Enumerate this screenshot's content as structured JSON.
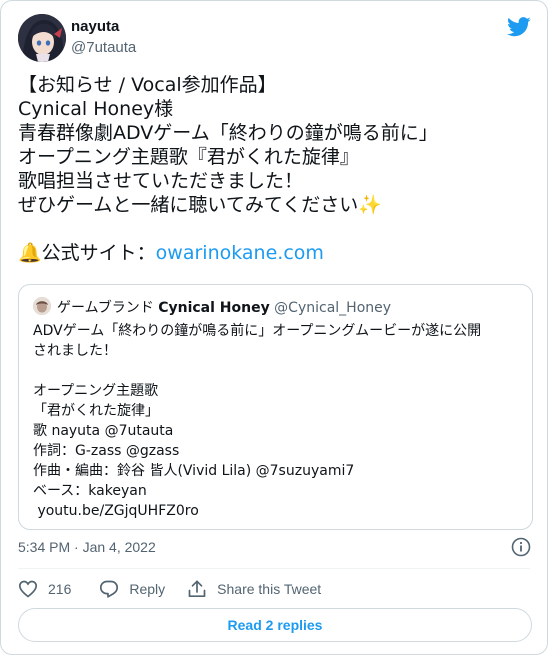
{
  "author": {
    "name": "nayuta",
    "handle": "@7utauta"
  },
  "tweet": {
    "lines": [
      "【お知らせ / Vocal参加作品】",
      "Cynical Honey様",
      "青春群像劇ADVゲーム「終わりの鐘が鳴る前に」",
      "オープニング主題歌『君がくれた旋律』",
      "歌唱担当させていただきました！",
      "ぜひゲームと一緒に聴いてみてください✨"
    ],
    "site_label": "🔔公式サイト：",
    "site_link": "owarinokane.com",
    "timestamp": "5:34 PM · Jan 4, 2022"
  },
  "quote": {
    "prefix": "ゲームブランド",
    "name": "Cynical Honey",
    "handle": "@Cynical_Honey",
    "lines": [
      "ADVゲーム「終わりの鐘が鳴る前に」オープニングムービーが遂に公開",
      "されました！",
      "",
      "オープニング主題歌",
      "「君がくれた旋律」",
      "歌 nayuta @7utauta",
      "作詞：G-zass @gzass",
      "作曲・編曲：鈴谷 皆人(Vivid Lila) @7suzuyami7",
      "ベース：kakeyan",
      " youtu.be/ZGjqUHFZ0ro"
    ]
  },
  "actions": {
    "like_count": "216",
    "reply_label": "Reply",
    "share_label": "Share this Tweet"
  },
  "read_replies_label": "Read 2 replies",
  "colors": {
    "accent": "#1d9bf0",
    "text": "#0f1419",
    "secondary": "#536471",
    "border": "#cfd9de"
  }
}
